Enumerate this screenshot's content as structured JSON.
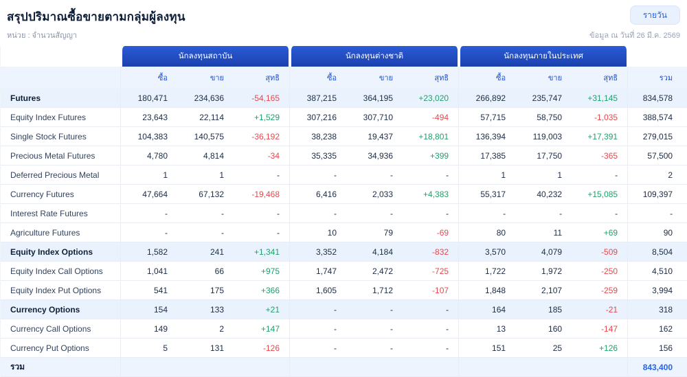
{
  "header": {
    "title": "สรุปปริมาณซื้อขายตามกลุ่มผู้ลงทุน",
    "daily_button": "รายวัน",
    "unit_label": "หน่วย : จำนวนสัญญา",
    "data_date": "ข้อมูล ณ วันที่ 26 มี.ค. 2569"
  },
  "colors": {
    "accent": "#1d4ed8",
    "positive": "#1fa06b",
    "negative": "#e5484d",
    "header_blue_1": "#2a5bd7",
    "header_blue_2": "#1c41ae",
    "highlight": "#eaf2fd",
    "subhead": "#edf4fe"
  },
  "table": {
    "groups": [
      "นักลงทุนสถาบัน",
      "นักลงทุนต่างชาติ",
      "นักลงทุนภายในประเทศ"
    ],
    "sub_columns": [
      "ซื้อ",
      "ขาย",
      "สุทธิ"
    ],
    "total_column": "รวม",
    "rows": [
      {
        "label": "Futures",
        "type": "section",
        "cells": [
          "180,471",
          "234,636",
          "-54,165",
          "387,215",
          "364,195",
          "+23,020",
          "266,892",
          "235,747",
          "+31,145",
          "834,578"
        ]
      },
      {
        "label": "Equity Index Futures",
        "type": "normal",
        "cells": [
          "23,643",
          "22,114",
          "+1,529",
          "307,216",
          "307,710",
          "-494",
          "57,715",
          "58,750",
          "-1,035",
          "388,574"
        ]
      },
      {
        "label": "Single Stock Futures",
        "type": "normal",
        "cells": [
          "104,383",
          "140,575",
          "-36,192",
          "38,238",
          "19,437",
          "+18,801",
          "136,394",
          "119,003",
          "+17,391",
          "279,015"
        ]
      },
      {
        "label": "Precious Metal Futures",
        "type": "normal",
        "cells": [
          "4,780",
          "4,814",
          "-34",
          "35,335",
          "34,936",
          "+399",
          "17,385",
          "17,750",
          "-365",
          "57,500"
        ]
      },
      {
        "label": "Deferred Precious Metal",
        "type": "normal",
        "cells": [
          "1",
          "1",
          "-",
          "-",
          "-",
          "-",
          "1",
          "1",
          "-",
          "2"
        ]
      },
      {
        "label": "Currency Futures",
        "type": "normal",
        "cells": [
          "47,664",
          "67,132",
          "-19,468",
          "6,416",
          "2,033",
          "+4,383",
          "55,317",
          "40,232",
          "+15,085",
          "109,397"
        ]
      },
      {
        "label": "Interest Rate Futures",
        "type": "normal",
        "cells": [
          "-",
          "-",
          "-",
          "-",
          "-",
          "-",
          "-",
          "-",
          "-",
          "-"
        ]
      },
      {
        "label": "Agriculture Futures",
        "type": "normal",
        "cells": [
          "-",
          "-",
          "-",
          "10",
          "79",
          "-69",
          "80",
          "11",
          "+69",
          "90"
        ]
      },
      {
        "label": "Equity Index Options",
        "type": "section",
        "cells": [
          "1,582",
          "241",
          "+1,341",
          "3,352",
          "4,184",
          "-832",
          "3,570",
          "4,079",
          "-509",
          "8,504"
        ]
      },
      {
        "label": "Equity Index Call Options",
        "type": "normal",
        "cells": [
          "1,041",
          "66",
          "+975",
          "1,747",
          "2,472",
          "-725",
          "1,722",
          "1,972",
          "-250",
          "4,510"
        ]
      },
      {
        "label": "Equity Index Put Options",
        "type": "normal",
        "cells": [
          "541",
          "175",
          "+366",
          "1,605",
          "1,712",
          "-107",
          "1,848",
          "2,107",
          "-259",
          "3,994"
        ]
      },
      {
        "label": "Currency Options",
        "type": "section",
        "cells": [
          "154",
          "133",
          "+21",
          "-",
          "-",
          "-",
          "164",
          "185",
          "-21",
          "318"
        ]
      },
      {
        "label": "Currency Call Options",
        "type": "normal",
        "cells": [
          "149",
          "2",
          "+147",
          "-",
          "-",
          "-",
          "13",
          "160",
          "-147",
          "162"
        ]
      },
      {
        "label": "Currency Put Options",
        "type": "normal",
        "cells": [
          "5",
          "131",
          "-126",
          "-",
          "-",
          "-",
          "151",
          "25",
          "+126",
          "156"
        ]
      },
      {
        "label": "รวม",
        "type": "total",
        "cells": [
          "",
          "",
          "",
          "",
          "",
          "",
          "",
          "",
          "",
          "843,400"
        ]
      }
    ]
  }
}
